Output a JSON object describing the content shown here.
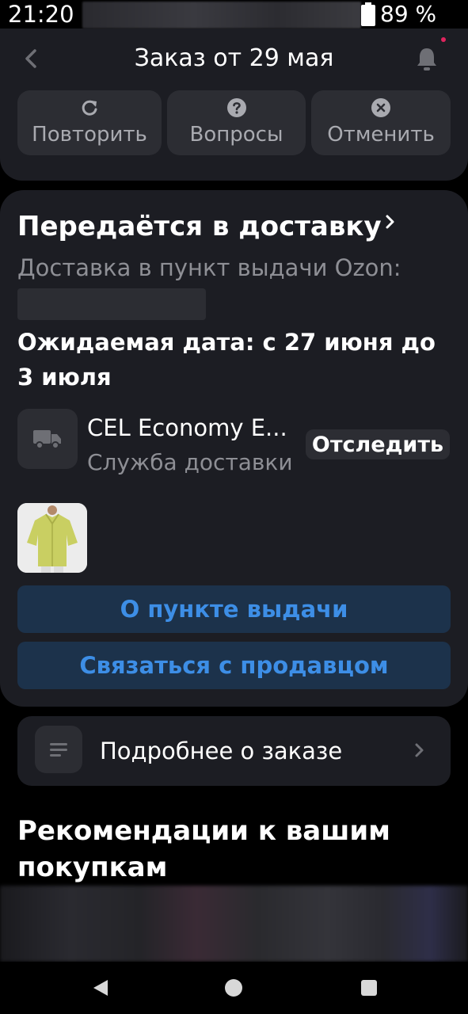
{
  "status_bar": {
    "time": "21:20",
    "battery": "89 %"
  },
  "header": {
    "title": "Заказ от 29 мая"
  },
  "actions": [
    {
      "label": "Повторить",
      "icon": "refresh-icon"
    },
    {
      "label": "Вопросы",
      "icon": "question-icon"
    },
    {
      "label": "Отменить",
      "icon": "cancel-icon"
    }
  ],
  "delivery": {
    "status": "Передаётся в доставку",
    "type": "Доставка в пункт выдачи Ozon:",
    "expected": "Ожидаемая дата: с 27 июня до 3 июля",
    "carrier_name": "CEL Economy E...",
    "carrier_sub": "Служба доставки",
    "track_label": "Отследить"
  },
  "buttons": {
    "pickup_info": "О пункте выдачи",
    "contact_seller": "Связаться с продавцом"
  },
  "details": {
    "label": "Подробнее о заказе"
  },
  "recommendations": {
    "title": "Рекомендации к вашим покупкам"
  },
  "colors": {
    "background": "#000000",
    "card": "#1c1d23",
    "button": "#2c2d33",
    "accent_blue": "#3d8ee6",
    "blue_button_bg": "#1c324b",
    "notification_dot": "#e0245e"
  }
}
